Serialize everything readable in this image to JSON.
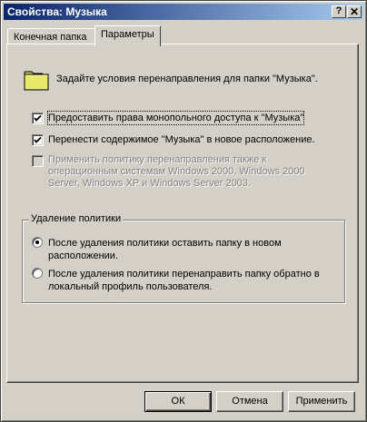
{
  "window": {
    "title": "Свойства: Музыка",
    "help_label": "?",
    "close_label": "✕"
  },
  "tabs": [
    {
      "label": "Конечная папка",
      "active": false
    },
    {
      "label": "Параметры",
      "active": true
    }
  ],
  "intro_text": "Задайте условия перенаправления для папки \"Музыка\".",
  "options": [
    {
      "label": "Предоставить права монопольного доступа к \"Музыка\"",
      "checked": true,
      "enabled": true
    },
    {
      "label": "Перенести содержимое \"Музыка\" в новое расположение.",
      "checked": true,
      "enabled": true
    },
    {
      "label_lines": [
        "Применить политику перенаправления также к",
        "операционным системам Windows 2000, Windows 2000",
        "Server, Windows XP и Windows Server 2003."
      ],
      "checked": false,
      "enabled": false
    }
  ],
  "policy_removal": {
    "legend": "Удаление политики",
    "radios": [
      {
        "lines": [
          "После удаления политики оставить папку в новом",
          "расположении."
        ],
        "selected": true
      },
      {
        "lines": [
          "После удаления политики перенаправить папку обратно в",
          "локальный профиль пользователя."
        ],
        "selected": false
      }
    ]
  },
  "buttons": {
    "ok": "ОК",
    "cancel": "Отмена",
    "apply": "Применить"
  },
  "colors": {
    "titlebar_start": "#0a246a",
    "titlebar_end": "#a6caf0",
    "face": "#d4d0c8",
    "folder": "#e8e86a"
  }
}
